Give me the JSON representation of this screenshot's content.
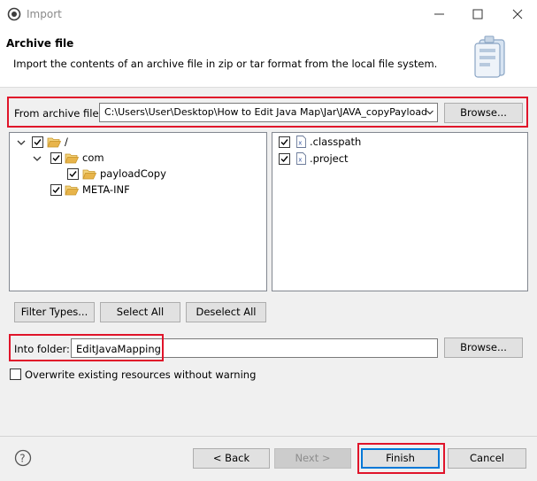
{
  "window": {
    "title": "Import",
    "controls": [
      "minimize-icon",
      "maximize-icon",
      "close-icon"
    ]
  },
  "header": {
    "title": "Archive file",
    "description": "Import the contents of an archive file in zip or tar format from the local file system."
  },
  "archive": {
    "label": "From archive file:",
    "value": "C:\\Users\\User\\Desktop\\How to Edit Java Map\\Jar\\JAVA_copyPayload",
    "browse_label": "Browse..."
  },
  "tree": {
    "items": [
      {
        "label": "/",
        "checked": true,
        "expanded": true
      },
      {
        "label": "com",
        "checked": true,
        "expanded": true
      },
      {
        "label": "payloadCopy",
        "checked": true
      },
      {
        "label": "META-INF",
        "checked": true
      }
    ]
  },
  "files": {
    "items": [
      {
        "label": ".classpath",
        "checked": true
      },
      {
        "label": ".project",
        "checked": true
      }
    ]
  },
  "selection_buttons": {
    "filter_types": "Filter Types...",
    "select_all": "Select All",
    "deselect_all": "Deselect All"
  },
  "into_folder": {
    "label": "Into folder:",
    "value": "EditJavaMapping",
    "browse_label": "Browse..."
  },
  "overwrite": {
    "label": "Overwrite existing resources without warning",
    "checked": false
  },
  "footer": {
    "back": "< Back",
    "next": "Next >",
    "finish": "Finish",
    "cancel": "Cancel"
  },
  "colors": {
    "highlight_outline": "#e0142a",
    "default_button_border": "#0078d7",
    "folder": "#e8b44a"
  }
}
